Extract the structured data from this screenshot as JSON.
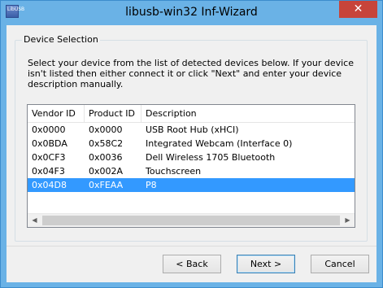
{
  "window": {
    "title": "libusb-win32 Inf-Wizard",
    "icon_label": "LibUSB",
    "close_glyph": "✕"
  },
  "group": {
    "title": "Device Selection",
    "instructions": "Select your device from the list of detected devices below. If your device isn't listed then either connect it or click \"Next\" and enter your device description manually."
  },
  "table": {
    "columns": [
      "Vendor ID",
      "Product ID",
      "Description"
    ],
    "rows": [
      [
        "0x0000",
        "0x0000",
        "USB Root Hub (xHCI)"
      ],
      [
        "0x0BDA",
        "0x58C2",
        "Integrated Webcam (Interface 0)"
      ],
      [
        "0x0CF3",
        "0x0036",
        "Dell Wireless 1705 Bluetooth"
      ],
      [
        "0x04F3",
        "0x002A",
        "Touchscreen"
      ],
      [
        "0x04D8",
        "0xFEAA",
        "P8"
      ]
    ],
    "selected_row": 4,
    "scroll_left": "◀",
    "scroll_right": "▶"
  },
  "buttons": {
    "back": "< Back",
    "next": "Next >",
    "cancel": "Cancel"
  },
  "colors": {
    "titlebar": "#6ab2e6",
    "close_button": "#c7443a",
    "selection": "#3399ff"
  }
}
